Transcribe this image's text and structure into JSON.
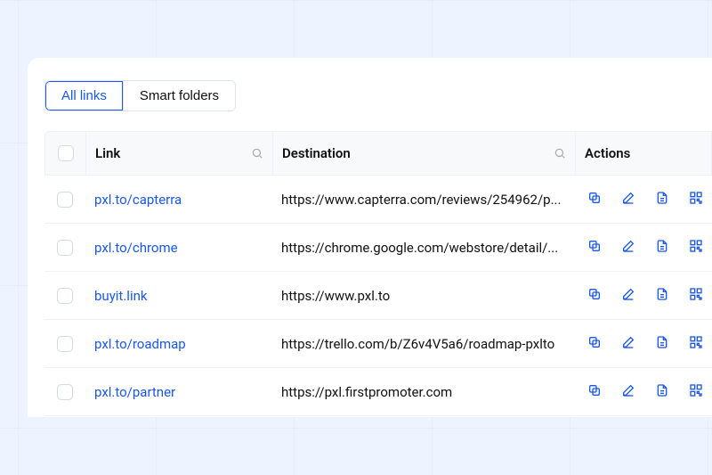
{
  "tabs": {
    "all_links": "All links",
    "smart_folders": "Smart folders"
  },
  "headers": {
    "link": "Link",
    "destination": "Destination",
    "actions": "Actions"
  },
  "rows": [
    {
      "link": "pxl.to/capterra",
      "destination": "https://www.capterra.com/reviews/254962/p..."
    },
    {
      "link": "pxl.to/chrome",
      "destination": "https://chrome.google.com/webstore/detail/..."
    },
    {
      "link": "buyit.link",
      "destination": "https://www.pxl.to"
    },
    {
      "link": "pxl.to/roadmap",
      "destination": "https://trello.com/b/Z6v4V5a6/roadmap-pxlto"
    },
    {
      "link": "pxl.to/partner",
      "destination": "https://pxl.firstpromoter.com"
    }
  ],
  "icons": {
    "copy": "copy-icon",
    "edit": "edit-icon",
    "file": "file-icon",
    "qr": "qr-icon"
  }
}
